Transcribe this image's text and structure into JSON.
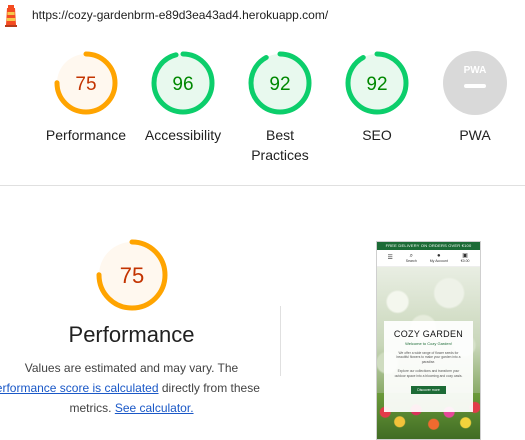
{
  "url": "https://cozy-gardenbrm-e89d3ea43ad4.herokuapp.com/",
  "colors": {
    "orange": "#ffa400",
    "orange_text": "#c33300",
    "orange_bg": "#fff8ef",
    "green": "#0cce6b",
    "green_text": "#008800",
    "green_bg": "#e8f9ee",
    "gray": "#cbcbcb",
    "link": "#1a58c7"
  },
  "scores": [
    {
      "value": "75",
      "label": "Performance",
      "score": 0.75,
      "status": "average"
    },
    {
      "value": "96",
      "label": "Accessibility",
      "score": 0.96,
      "status": "pass"
    },
    {
      "value": "92",
      "label": "Best Practices",
      "score": 0.92,
      "status": "pass"
    },
    {
      "value": "92",
      "label": "SEO",
      "score": 0.92,
      "status": "pass"
    },
    {
      "value": "",
      "label": "PWA",
      "score": null,
      "status": "na",
      "badge": "PWA"
    }
  ],
  "performance": {
    "value": "75",
    "score": 0.75,
    "title": "Performance",
    "desc_1": "Values are estimated and may vary. The",
    "desc_link": "performance score is calculated",
    "desc_2": "directly from these",
    "desc_3": "metrics.",
    "calc_link": "See calculator."
  },
  "thumbnail": {
    "banner": "FREE DELIVERY ON ORDERS OVER €100",
    "nav": [
      {
        "icon": "search-icon",
        "label": "Search"
      },
      {
        "icon": "user-icon",
        "label": "My Account"
      },
      {
        "icon": "cart-icon",
        "label": "€0.00"
      }
    ],
    "title": "COZY GARDEN",
    "subtitle": "Welcome to Cozy Garden!",
    "para1": "We offer a wide range of flower seeds for beautiful flowers to make your garden into a paradise.",
    "para2": "Explore our collections and transform your outdoor space into a blooming and cozy oasis.",
    "button": "Discover more"
  }
}
